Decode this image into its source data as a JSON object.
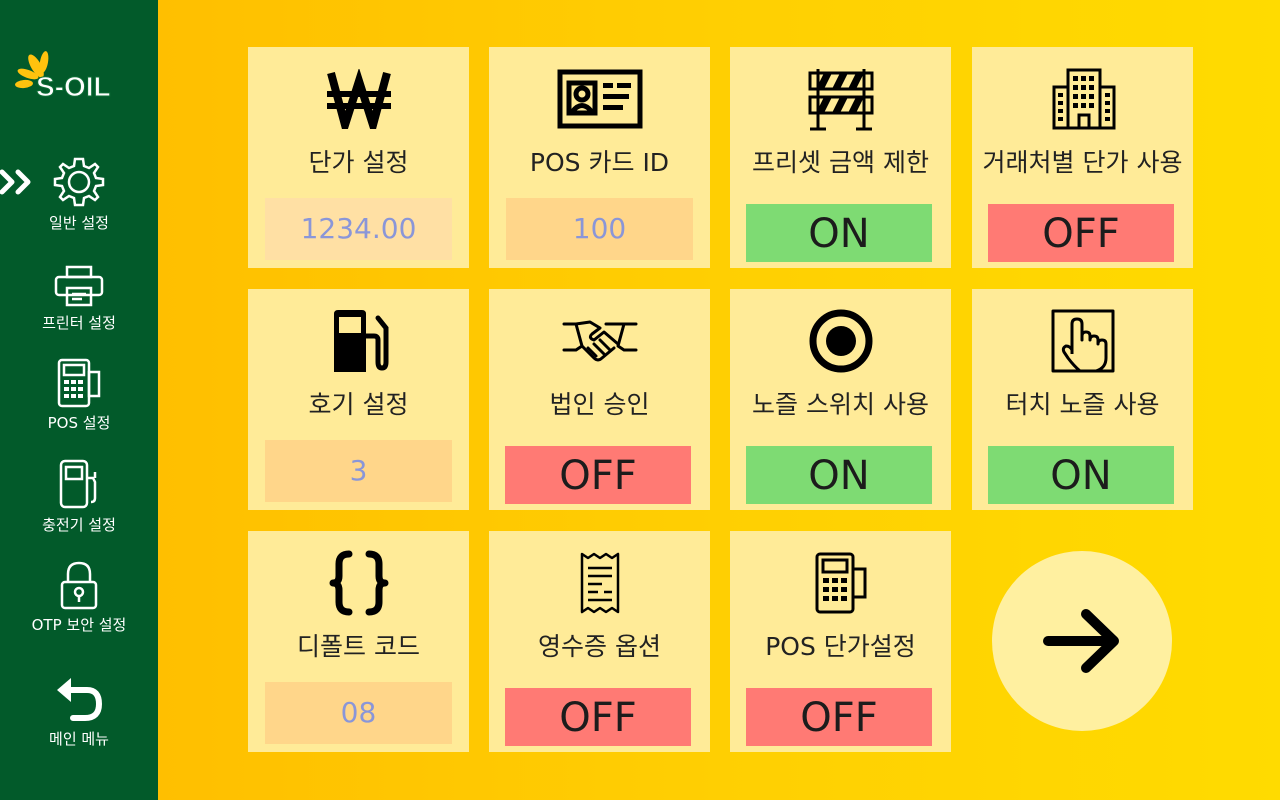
{
  "brand": {
    "logo_text": "S-OIL"
  },
  "sidebar": {
    "items": [
      {
        "label": "일반 설정",
        "icon": "gear-icon",
        "active": true
      },
      {
        "label": "프린터 설정",
        "icon": "printer-icon"
      },
      {
        "label": "POS 설정",
        "icon": "card-terminal-icon"
      },
      {
        "label": "충전기 설정",
        "icon": "charger-icon"
      },
      {
        "label": "OTP 보안 설정",
        "icon": "lock-icon"
      },
      {
        "label": "메인 메뉴",
        "icon": "back-arrow-icon"
      }
    ]
  },
  "tiles": [
    {
      "label": "단가 설정",
      "icon": "won-icon",
      "type": "value",
      "value": "1234.00"
    },
    {
      "label": "POS 카드 ID",
      "icon": "id-card-icon",
      "type": "value",
      "value": "100"
    },
    {
      "label": "프리셋 금액 제한",
      "icon": "barrier-icon",
      "type": "toggle",
      "value": "ON"
    },
    {
      "label": "거래처별 단가 사용",
      "icon": "building-icon",
      "type": "toggle",
      "value": "OFF"
    },
    {
      "label": "호기 설정",
      "icon": "fuel-pump-icon",
      "type": "value",
      "value": "3"
    },
    {
      "label": "법인 승인",
      "icon": "handshake-icon",
      "type": "toggle",
      "value": "OFF"
    },
    {
      "label": "노즐 스위치 사용",
      "icon": "radio-button-icon",
      "type": "toggle",
      "value": "ON"
    },
    {
      "label": "터치 노즐 사용",
      "icon": "touch-icon",
      "type": "toggle",
      "value": "ON"
    },
    {
      "label": "디폴트 코드",
      "icon": "braces-icon",
      "type": "value",
      "value": "08"
    },
    {
      "label": "영수증 옵션",
      "icon": "receipt-icon",
      "type": "toggle",
      "value": "OFF"
    },
    {
      "label": "POS 단가설정",
      "icon": "card-terminal-icon",
      "type": "toggle",
      "value": "OFF"
    }
  ],
  "next_button": {
    "icon": "arrow-right-icon"
  },
  "colors": {
    "sidebar": "#025a2a",
    "on": "#7edb73",
    "off": "#ff7a74",
    "tile": "#ffeb98"
  }
}
